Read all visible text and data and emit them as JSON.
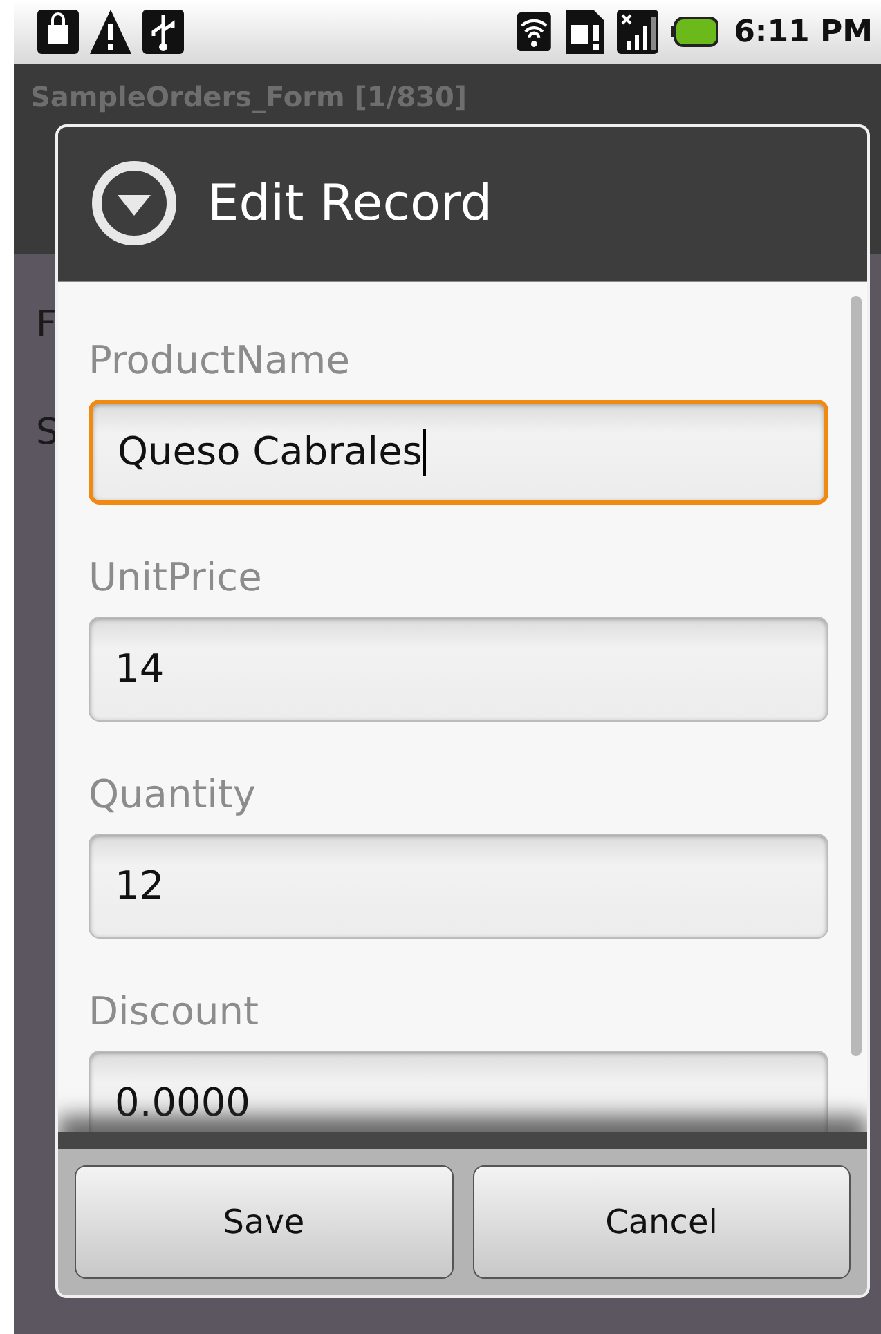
{
  "status_bar": {
    "time": "6:11 PM"
  },
  "app": {
    "title": "SampleOrders_Form [1/830]",
    "background_labels": [
      "F",
      "S"
    ]
  },
  "dialog": {
    "title": "Edit Record",
    "fields": [
      {
        "label": "ProductName",
        "value": "Queso Cabrales",
        "focused": true
      },
      {
        "label": "UnitPrice",
        "value": "14",
        "focused": false
      },
      {
        "label": "Quantity",
        "value": "12",
        "focused": false
      },
      {
        "label": "Discount",
        "value": "0.0000",
        "focused": false
      }
    ],
    "buttons": [
      "Save",
      "Cancel"
    ]
  }
}
